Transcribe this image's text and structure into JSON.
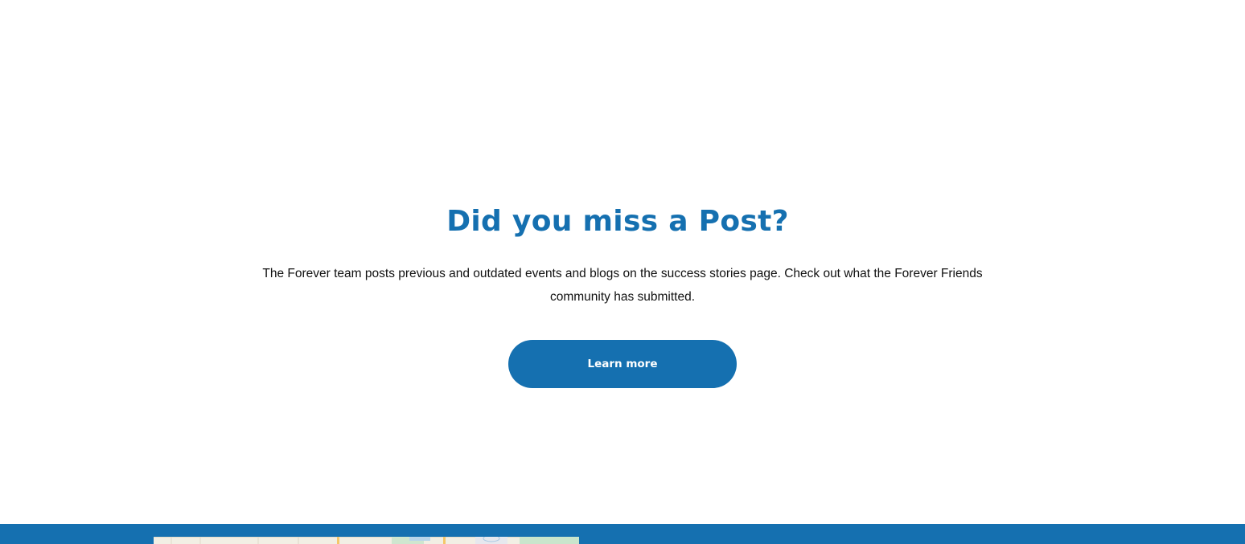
{
  "cta": {
    "title": "Did you miss a Post?",
    "description": "The Forever team posts previous and outdated events and blogs on the success stories page. Check out what the Forever Friends community has submitted.",
    "button_label": "Learn more"
  },
  "colors": {
    "brand_blue": "#1570b0",
    "background": "#ffffff",
    "text": "#111111"
  }
}
